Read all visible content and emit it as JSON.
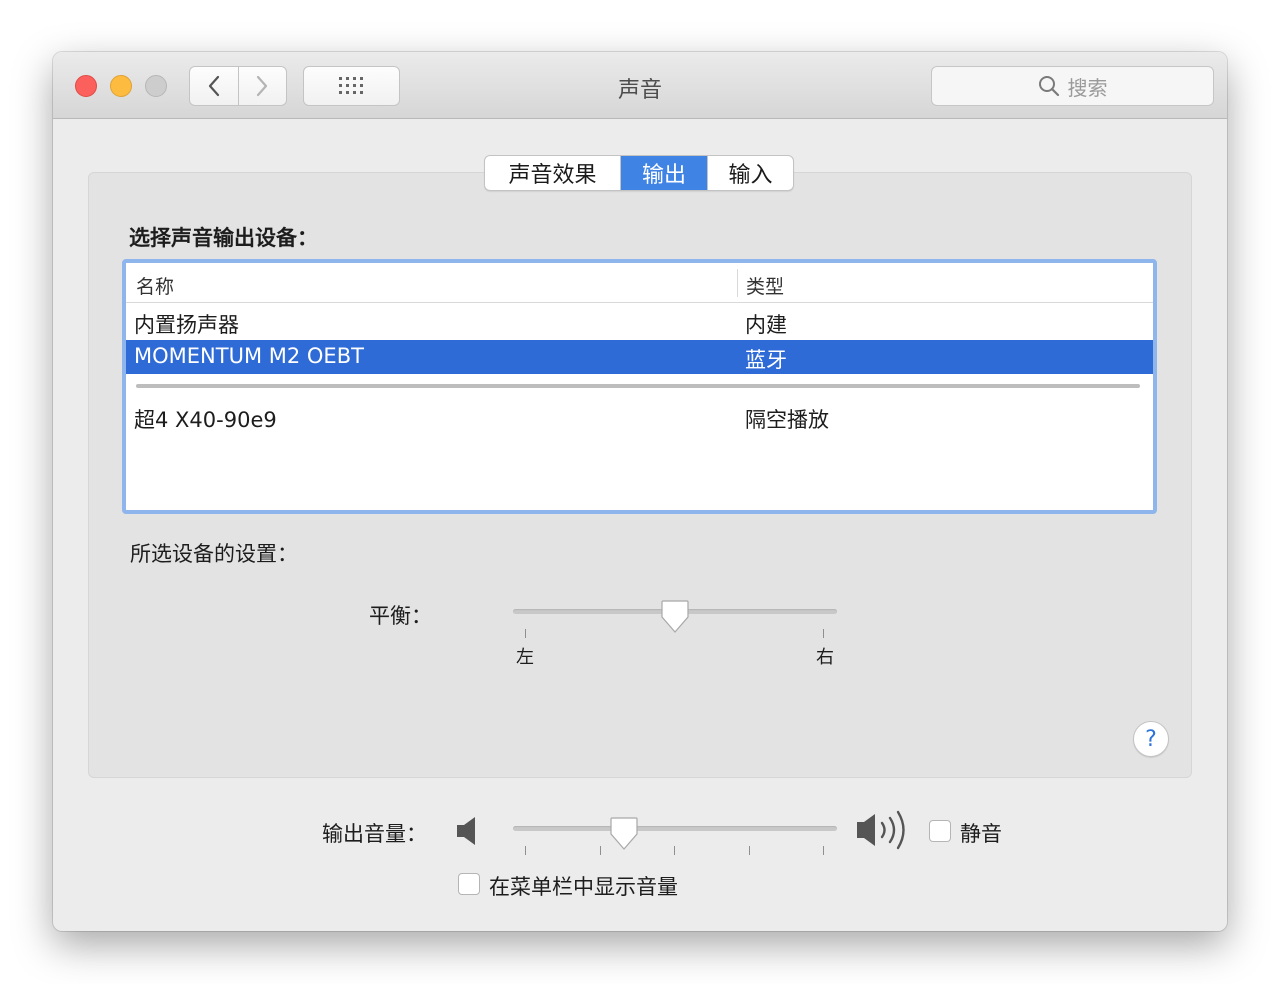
{
  "window": {
    "title": "声音"
  },
  "toolbar": {
    "back_icon": "chevron-left-icon",
    "forward_icon": "chevron-right-icon",
    "grid_icon": "grid-icon",
    "search_placeholder": "搜索"
  },
  "tabs": [
    {
      "label": "声音效果",
      "selected": false
    },
    {
      "label": "输出",
      "selected": true
    },
    {
      "label": "输入",
      "selected": false
    }
  ],
  "device_section": {
    "label": "选择声音输出设备：",
    "columns": [
      "名称",
      "类型"
    ],
    "rows": [
      {
        "name": "内置扬声器",
        "type": "内建",
        "selected": false
      },
      {
        "name": "MOMENTUM M2 OEBT",
        "type": "蓝牙",
        "selected": true
      },
      {
        "name": "超4 X40-90e9",
        "type": "隔空播放",
        "selected": false
      }
    ]
  },
  "settings_section": {
    "label": "所选设备的设置：",
    "balance": {
      "label": "平衡：",
      "left_label": "左",
      "right_label": "右",
      "value": 0.5
    }
  },
  "help": {
    "label": "?"
  },
  "output_volume": {
    "label": "输出音量：",
    "value": 0.33,
    "mute_label": "静音",
    "mute_checked": false,
    "menubar_label": "在菜单栏中显示音量",
    "menubar_checked": false
  },
  "colors": {
    "accent": "#3f84e5",
    "selection": "#2f6bd6",
    "close": "#fc605c",
    "minimize": "#fdbc40",
    "zoom": "#cdcdcd"
  }
}
